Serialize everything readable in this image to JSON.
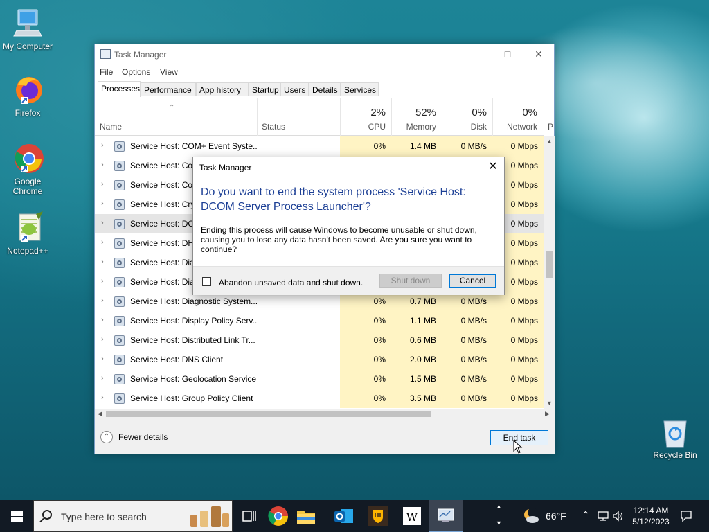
{
  "desktop": {
    "icons": [
      {
        "label": "My Computer"
      },
      {
        "label": "Firefox"
      },
      {
        "label": "Google Chrome"
      },
      {
        "label": "Notepad++"
      },
      {
        "label": "Recycle Bin"
      }
    ]
  },
  "window": {
    "title": "Task Manager",
    "menu": [
      "File",
      "Options",
      "View"
    ],
    "tabs": [
      "Processes",
      "Performance",
      "App history",
      "Startup",
      "Users",
      "Details",
      "Services"
    ],
    "active_tab": "Processes",
    "columns": {
      "name": "Name",
      "status": "Status",
      "cpu": {
        "pct": "2%",
        "label": "CPU"
      },
      "memory": {
        "pct": "52%",
        "label": "Memory"
      },
      "disk": {
        "pct": "0%",
        "label": "Disk"
      },
      "network": {
        "pct": "0%",
        "label": "Network"
      },
      "power_cut": "P"
    },
    "rows": [
      {
        "name": "Service Host: COM+ Event Syste...",
        "cpu": "0%",
        "memory": "1.4 MB",
        "disk": "0 MB/s",
        "network": "0 Mbps"
      },
      {
        "name": "Service Host: Con",
        "cpu": "",
        "memory": "",
        "disk": "",
        "network": "0 Mbps"
      },
      {
        "name": "Service Host: Con",
        "cpu": "",
        "memory": "",
        "disk": "",
        "network": "0 Mbps"
      },
      {
        "name": "Service Host: Cryp",
        "cpu": "",
        "memory": "",
        "disk": "",
        "network": "0 Mbps"
      },
      {
        "name": "Service Host: DCC",
        "cpu": "",
        "memory": "",
        "disk": "",
        "network": "0 Mbps",
        "selected": true
      },
      {
        "name": "Service Host: DHC",
        "cpu": "",
        "memory": "",
        "disk": "",
        "network": "0 Mbps"
      },
      {
        "name": "Service Host: Diag",
        "cpu": "",
        "memory": "",
        "disk": "",
        "network": "0 Mbps"
      },
      {
        "name": "Service Host: Diag",
        "cpu": "",
        "memory": "",
        "disk": "",
        "network": "0 Mbps"
      },
      {
        "name": "Service Host: Diagnostic System...",
        "cpu": "0%",
        "memory": "0.7 MB",
        "disk": "0 MB/s",
        "network": "0 Mbps"
      },
      {
        "name": "Service Host: Display Policy Serv...",
        "cpu": "0%",
        "memory": "1.1 MB",
        "disk": "0 MB/s",
        "network": "0 Mbps"
      },
      {
        "name": "Service Host: Distributed Link Tr...",
        "cpu": "0%",
        "memory": "0.6 MB",
        "disk": "0 MB/s",
        "network": "0 Mbps"
      },
      {
        "name": "Service Host: DNS Client",
        "cpu": "0%",
        "memory": "2.0 MB",
        "disk": "0 MB/s",
        "network": "0 Mbps"
      },
      {
        "name": "Service Host: Geolocation Service",
        "cpu": "0%",
        "memory": "1.5 MB",
        "disk": "0 MB/s",
        "network": "0 Mbps"
      },
      {
        "name": "Service Host: Group Policy Client",
        "cpu": "0%",
        "memory": "3.5 MB",
        "disk": "0 MB/s",
        "network": "0 Mbps"
      }
    ],
    "footer": {
      "fewer_details": "Fewer details",
      "end_task": "End task"
    }
  },
  "dialog": {
    "title": "Task Manager",
    "question": "Do you want to end the system process 'Service Host: DCOM Server Process Launcher'?",
    "message": "Ending this process will cause Windows to become unusable or shut down, causing you to lose any data hasn't been saved. Are you sure you want to continue?",
    "checkbox_label": "Abandon unsaved data and shut down.",
    "checkbox_checked": false,
    "shutdown_label": "Shut down",
    "cancel_label": "Cancel"
  },
  "taskbar": {
    "search_placeholder": "Type here to search",
    "weather": "66°F",
    "time": "12:14 AM",
    "date": "5/12/2023"
  }
}
